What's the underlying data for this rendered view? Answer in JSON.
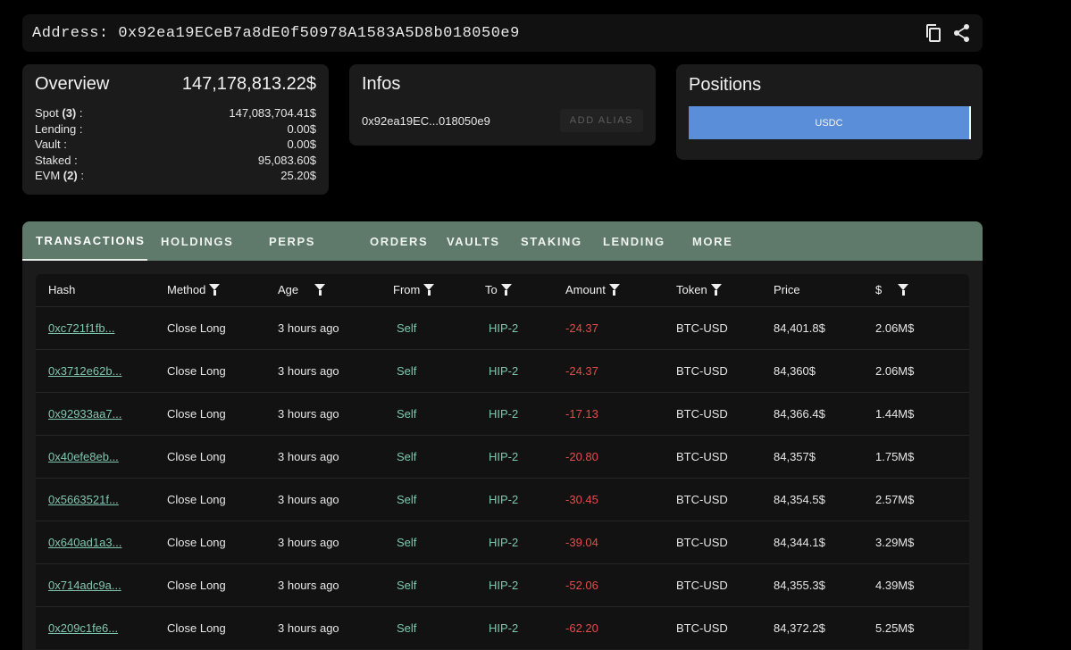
{
  "address_bar": {
    "label": "Address:",
    "address": "0x92ea19ECeB7a8dE0f50978A1583A5D8b018050e9",
    "icons": [
      "copy-icon",
      "share-icon"
    ]
  },
  "overview": {
    "title": "Overview",
    "total": "147,178,813.22$",
    "rows": [
      {
        "label": "Spot",
        "count": "(3)",
        "suffix": ":",
        "value": "147,083,704.41$"
      },
      {
        "label": "Lending :",
        "count": "",
        "suffix": "",
        "value": "0.00$"
      },
      {
        "label": "Vault :",
        "count": "",
        "suffix": "",
        "value": "0.00$"
      },
      {
        "label": "Staked :",
        "count": "",
        "suffix": "",
        "value": "95,083.60$"
      },
      {
        "label": "EVM",
        "count": "(2)",
        "suffix": ":",
        "value": "25.20$"
      }
    ]
  },
  "infos": {
    "title": "Infos",
    "short_address": "0x92ea19EC...018050e9",
    "alias_button": "ADD ALIAS"
  },
  "positions": {
    "title": "Positions",
    "bar_label": "USDC",
    "bar_color": "#5b8ed8"
  },
  "tabs": [
    "TRANSACTIONS",
    "HOLDINGS",
    "PERPS",
    "ORDERS",
    "VAULTS",
    "STAKING",
    "LENDING",
    "MORE"
  ],
  "active_tab": "TRANSACTIONS",
  "table": {
    "columns": [
      {
        "label": "Hash",
        "filter": false
      },
      {
        "label": "Method",
        "filter": true
      },
      {
        "label": "Age",
        "filter": true
      },
      {
        "label": "From",
        "filter": true
      },
      {
        "label": "To",
        "filter": true
      },
      {
        "label": "Amount",
        "filter": true
      },
      {
        "label": "Token",
        "filter": true
      },
      {
        "label": "Price",
        "filter": false
      },
      {
        "label": "$",
        "filter": true
      }
    ],
    "rows": [
      {
        "hash": "0xc721f1fb...",
        "method": "Close Long",
        "age": "3 hours ago",
        "from": "Self",
        "to": "HIP-2",
        "amount": "24.37",
        "token": "BTC-USD",
        "price": "84,401.8$",
        "usd": "2.06M$"
      },
      {
        "hash": "0x3712e62b...",
        "method": "Close Long",
        "age": "3 hours ago",
        "from": "Self",
        "to": "HIP-2",
        "amount": "24.37",
        "token": "BTC-USD",
        "price": "84,360$",
        "usd": "2.06M$"
      },
      {
        "hash": "0x92933aa7...",
        "method": "Close Long",
        "age": "3 hours ago",
        "from": "Self",
        "to": "HIP-2",
        "amount": "17.13",
        "token": "BTC-USD",
        "price": "84,366.4$",
        "usd": "1.44M$"
      },
      {
        "hash": "0x40efe8eb...",
        "method": "Close Long",
        "age": "3 hours ago",
        "from": "Self",
        "to": "HIP-2",
        "amount": "20.80",
        "token": "BTC-USD",
        "price": "84,357$",
        "usd": "1.75M$"
      },
      {
        "hash": "0x5663521f...",
        "method": "Close Long",
        "age": "3 hours ago",
        "from": "Self",
        "to": "HIP-2",
        "amount": "30.45",
        "token": "BTC-USD",
        "price": "84,354.5$",
        "usd": "2.57M$"
      },
      {
        "hash": "0x640ad1a3...",
        "method": "Close Long",
        "age": "3 hours ago",
        "from": "Self",
        "to": "HIP-2",
        "amount": "39.04",
        "token": "BTC-USD",
        "price": "84,344.1$",
        "usd": "3.29M$"
      },
      {
        "hash": "0x714adc9a...",
        "method": "Close Long",
        "age": "3 hours ago",
        "from": "Self",
        "to": "HIP-2",
        "amount": "52.06",
        "token": "BTC-USD",
        "price": "84,355.3$",
        "usd": "4.39M$"
      },
      {
        "hash": "0x209c1fe6...",
        "method": "Close Long",
        "age": "3 hours ago",
        "from": "Self",
        "to": "HIP-2",
        "amount": "62.20",
        "token": "BTC-USD",
        "price": "84,372.2$",
        "usd": "5.25M$"
      }
    ],
    "colors": {
      "link": "#7fc7b0",
      "negative": "#e44b4b"
    }
  }
}
